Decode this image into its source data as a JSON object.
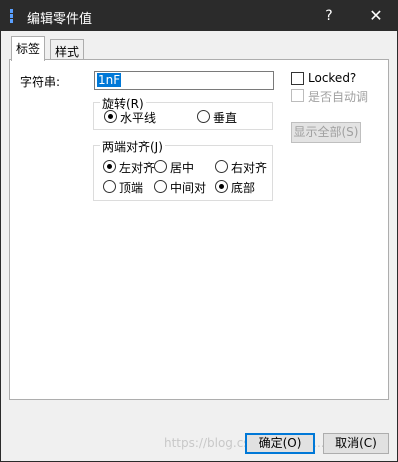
{
  "window": {
    "title": "编辑零件值",
    "help_label": "?",
    "close_label": "✕",
    "app_icon": "app-icon"
  },
  "tabs": [
    {
      "label": "标签",
      "active": true
    },
    {
      "label": "样式",
      "active": false
    }
  ],
  "form": {
    "string_label": "字符串:",
    "string_value": "1nF",
    "locked_label": "Locked?",
    "locked_checked": false,
    "auto_label": "是否自动调",
    "auto_checked": false,
    "auto_disabled": true,
    "show_all_label": "显示全部(S)",
    "show_all_disabled": true
  },
  "rotation": {
    "title": "旋转(R)",
    "options": [
      {
        "label": "水平线",
        "checked": true
      },
      {
        "label": "垂直",
        "checked": false
      }
    ]
  },
  "justify": {
    "title": "两端对齐(J)",
    "options": [
      {
        "label": "左对齐",
        "checked": true
      },
      {
        "label": "居中",
        "checked": false
      },
      {
        "label": "右对齐",
        "checked": false
      },
      {
        "label": "顶端",
        "checked": false
      },
      {
        "label": "中间对",
        "checked": false
      },
      {
        "label": "底部",
        "checked": true
      }
    ]
  },
  "footer": {
    "ok_label": "确定(O)",
    "cancel_label": "取消(C)",
    "watermark": "https://blog.csdn.net/ZHJ..."
  },
  "colors": {
    "titlebar": "#2b2b2b",
    "accent": "#0078d7"
  }
}
